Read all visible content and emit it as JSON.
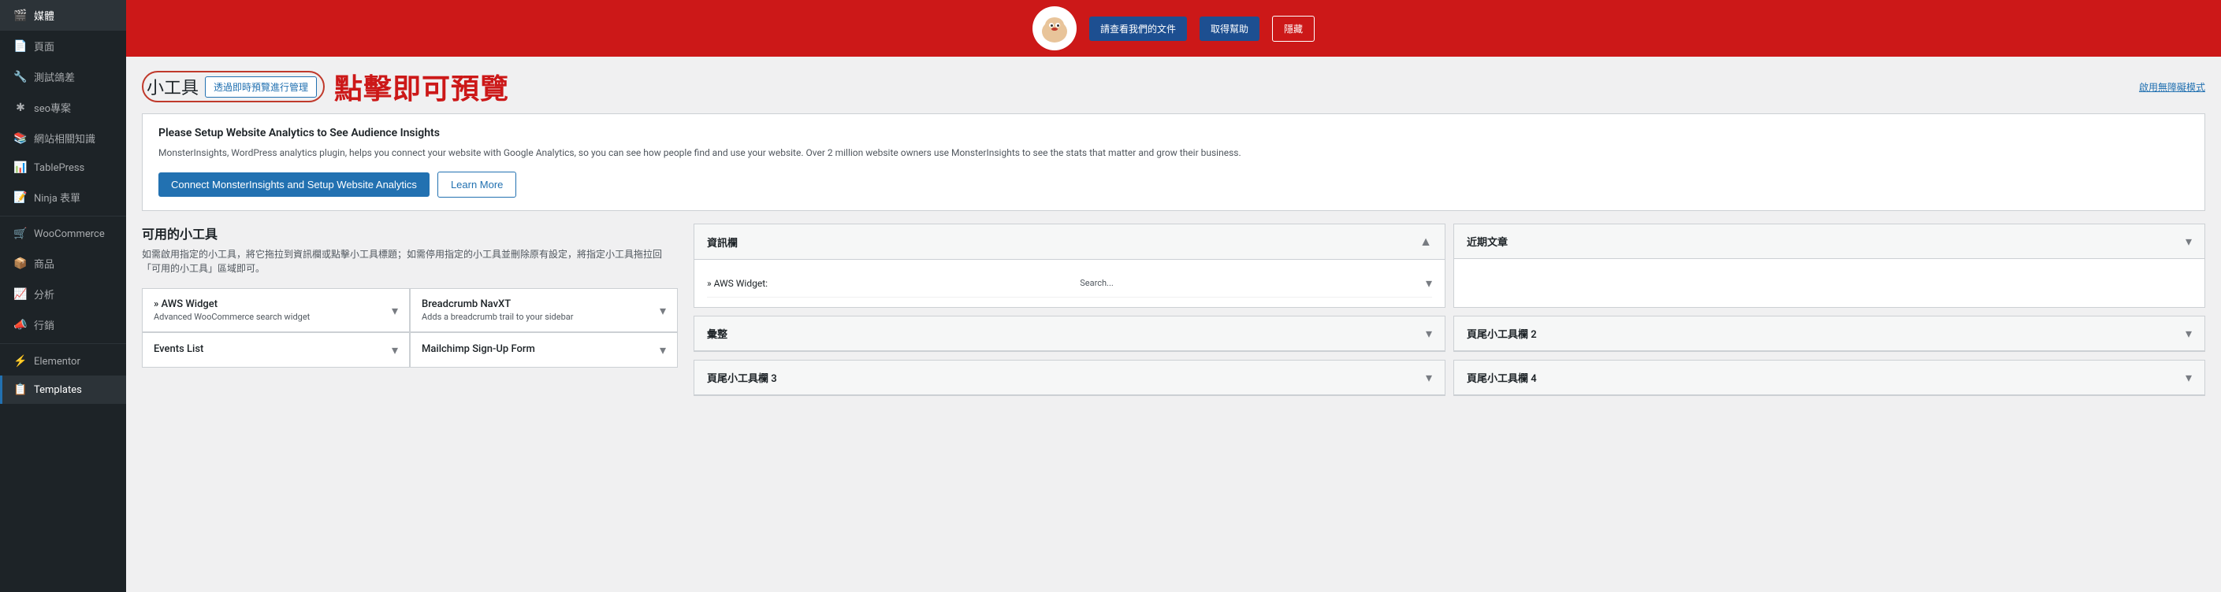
{
  "sidebar": {
    "items": [
      {
        "id": "media",
        "label": "媒體",
        "icon": "🎬"
      },
      {
        "id": "pages",
        "label": "頁面",
        "icon": "📄"
      },
      {
        "id": "testing",
        "label": "測試鴿差",
        "icon": "🔧"
      },
      {
        "id": "seo",
        "label": "seo專案",
        "icon": "✱"
      },
      {
        "id": "webknowledge",
        "label": "網站相關知識",
        "icon": "📚"
      },
      {
        "id": "tablepress",
        "label": "TablePress",
        "icon": "📊"
      },
      {
        "id": "ninjaforms",
        "label": "Ninja 表單",
        "icon": "📝"
      },
      {
        "id": "woocommerce",
        "label": "WooCommerce",
        "icon": "🛒"
      },
      {
        "id": "products",
        "label": "商品",
        "icon": "📦"
      },
      {
        "id": "analytics",
        "label": "分析",
        "icon": "📈"
      },
      {
        "id": "marketing",
        "label": "行銷",
        "icon": "📣"
      },
      {
        "id": "elementor",
        "label": "Elementor",
        "icon": "⚡"
      },
      {
        "id": "templates",
        "label": "Templates",
        "icon": "📋"
      }
    ]
  },
  "banner": {
    "btn1": "請查看我們的文件",
    "btn2": "取得幫助",
    "btn3": "隱藏"
  },
  "header": {
    "title": "小工具",
    "manage_btn": "透過即時預覽進行管理",
    "preview_text": "點擊即可預覽",
    "accessibility_link": "啟用無障礙模式"
  },
  "analytics_notice": {
    "title": "Please Setup Website Analytics to See Audience Insights",
    "description": "MonsterInsights, WordPress analytics plugin, helps you connect your website with Google Analytics, so you can see how people find and use your website. Over 2 million website owners use MonsterInsights to see the stats that matter and grow their business.",
    "connect_btn": "Connect MonsterInsights and Setup Website Analytics",
    "learn_btn": "Learn More"
  },
  "available_widgets": {
    "title": "可用的小工具",
    "description": "如需啟用指定的小工具，將它拖拉到資訊欄或點擊小工具標題；如需停用指定的小工具並刪除原有設定，將指定小工具拖拉回「可用的小工具」區域即可。",
    "widgets": [
      {
        "name": "» AWS Widget",
        "desc": "Advanced WooCommerce search widget"
      },
      {
        "name": "Breadcrumb NavXT",
        "desc": "Adds a breadcrumb trail to your sidebar"
      },
      {
        "name": "Events List",
        "desc": ""
      },
      {
        "name": "Mailchimp Sign-Up Form",
        "desc": ""
      }
    ]
  },
  "sidebars": {
    "sidebar1": {
      "title": "資訊欄",
      "widgets": [
        {
          "name": "» AWS Widget:",
          "label": "Search..."
        }
      ]
    },
    "sidebar2": {
      "title": "近期文章",
      "widgets": []
    },
    "sidebar3": {
      "title": "彙整",
      "widgets": []
    },
    "footer2": {
      "title": "頁尾小工具欄 2",
      "widgets": []
    },
    "footer3": {
      "title": "頁尾小工具欄 3",
      "widgets": []
    },
    "footer4": {
      "title": "頁尾小工具欄 4",
      "widgets": []
    }
  }
}
